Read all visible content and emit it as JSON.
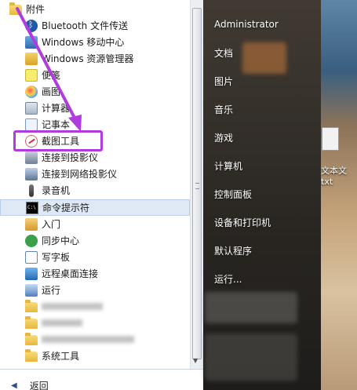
{
  "programs": {
    "folder_accessories": "附件",
    "items": [
      {
        "label": "Bluetooth 文件传送",
        "icon": "bluetooth-icon"
      },
      {
        "label": "Windows 移动中心",
        "icon": "mobility-center-icon"
      },
      {
        "label": "Windows 资源管理器",
        "icon": "explorer-icon"
      },
      {
        "label": "便笺",
        "icon": "sticky-notes-icon"
      },
      {
        "label": "画图",
        "icon": "paint-icon"
      },
      {
        "label": "计算器",
        "icon": "calculator-icon"
      },
      {
        "label": "记事本",
        "icon": "notepad-icon"
      },
      {
        "label": "截图工具",
        "icon": "snipping-tool-icon"
      },
      {
        "label": "连接到投影仪",
        "icon": "projector-icon"
      },
      {
        "label": "连接到网络投影仪",
        "icon": "network-projector-icon"
      },
      {
        "label": "录音机",
        "icon": "sound-recorder-icon"
      },
      {
        "label": "命令提示符",
        "icon": "command-prompt-icon"
      },
      {
        "label": "入门",
        "icon": "getting-started-icon"
      },
      {
        "label": "同步中心",
        "icon": "sync-center-icon"
      },
      {
        "label": "写字板",
        "icon": "wordpad-icon"
      },
      {
        "label": "远程桌面连接",
        "icon": "remote-desktop-icon"
      },
      {
        "label": "运行",
        "icon": "run-icon"
      }
    ],
    "system_tools": "系统工具",
    "back": "返回"
  },
  "right_menu": {
    "user": "Administrator",
    "documents": "文档",
    "pictures": "图片",
    "music": "音乐",
    "games": "游戏",
    "computer": "计算机",
    "control_panel": "控制面板",
    "devices_printers": "设备和打印机",
    "default_programs": "默认程序",
    "run": "运行..."
  },
  "desktop": {
    "file_label_line1": "文本文",
    "file_label_line2": "txt"
  },
  "colors": {
    "highlight": "#b03ce0",
    "selected_row": "#dfe9f6"
  }
}
